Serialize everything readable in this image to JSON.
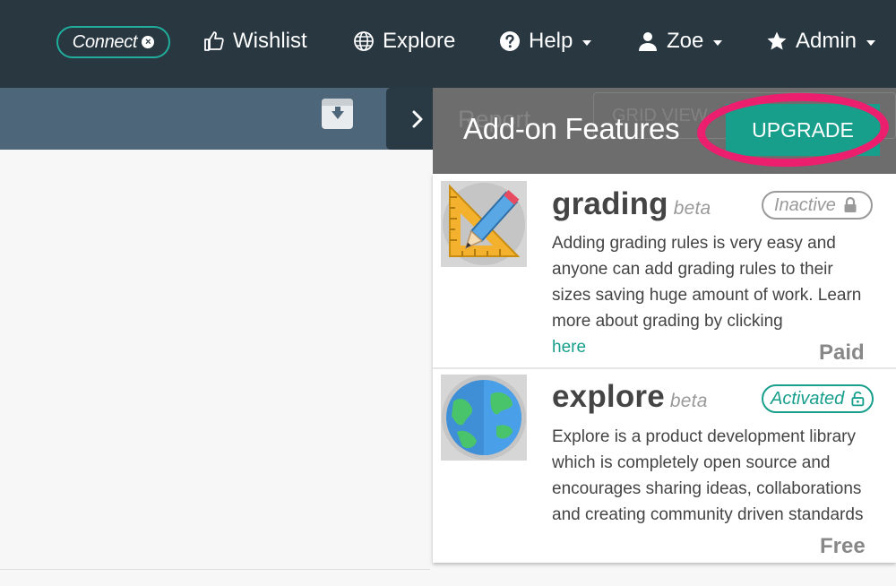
{
  "nav": {
    "connect_label": "Connect",
    "wishlist_label": "Wishlist",
    "explore_label": "Explore",
    "help_label": "Help",
    "user_label": "Zoe",
    "admin_label": "Admin"
  },
  "subbar": {
    "ghost_text": "Report",
    "ghost_grid_label": "GRID VIEW"
  },
  "panel": {
    "title": "Add-on Features",
    "upgrade_label": "UPGRADE",
    "features": [
      {
        "name": "grading",
        "tag": "beta",
        "status": "Inactive",
        "description": "Adding grading rules is very easy and anyone can add grading rules to their sizes saving huge amount of work. Learn more about grading by clicking",
        "link_text": "here",
        "price": "Paid",
        "icon": "ruler-pencil-icon"
      },
      {
        "name": "explore",
        "tag": "beta",
        "status": "Activated",
        "description": "Explore is a product development library which is completely open source and encourages sharing ideas, collaborations and creating community driven standards",
        "price": "Free",
        "icon": "globe-icon"
      }
    ]
  },
  "colors": {
    "nav_bg": "#283740",
    "subbar_bg": "#4e6679",
    "accent": "#179f8c",
    "highlight_ring": "#ec1e6e"
  }
}
